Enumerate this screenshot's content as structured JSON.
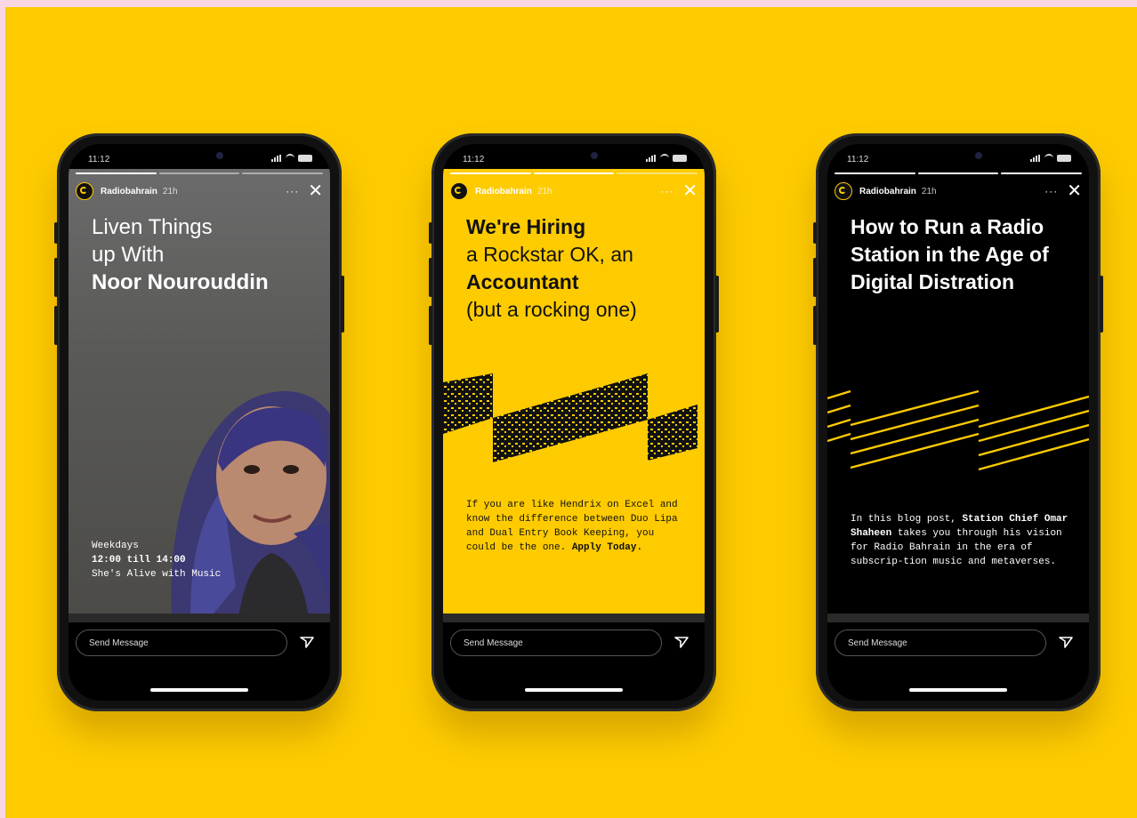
{
  "status": {
    "time": "11:12"
  },
  "stories": [
    {
      "user": "Radiobahrain",
      "age": "21h",
      "title_lines": [
        "Liven Things",
        "up With"
      ],
      "title_bold": "Noor Nourouddin",
      "schedule_day": "Weekdays",
      "schedule_time": "12:00 till 14:00",
      "schedule_show": "She's Alive with Music"
    },
    {
      "user": "Radiobahrain",
      "age": "21h",
      "title_bold_1": "We're Hiring",
      "title_2": "a Rockstar OK, an",
      "title_bold_3": "Accountant",
      "title_4": "(but a rocking one)",
      "body": "If you are like Hendrix on Excel and know the difference between Duo Lipa and Dual Entry Book Keeping, you could be the one.",
      "body_bold": "Apply Today."
    },
    {
      "user": "Radiobahrain",
      "age": "21h",
      "title_bold": "How to Run a Radio Station in the Age of Digital Distration",
      "body_1": "In this blog post,",
      "body_bold": "Station Chief Omar Shaheen",
      "body_2": "takes you through his vision for Radio Bahrain in the era of subscrip-tion music and metaverses."
    }
  ],
  "composer": {
    "placeholder": "Send Message"
  },
  "icons": {
    "send": "send-icon",
    "close": "close-icon",
    "more": "more-icon"
  },
  "colors": {
    "brand_yellow": "#fecb00",
    "background_pink": "#f8d7e3",
    "black": "#000000"
  }
}
